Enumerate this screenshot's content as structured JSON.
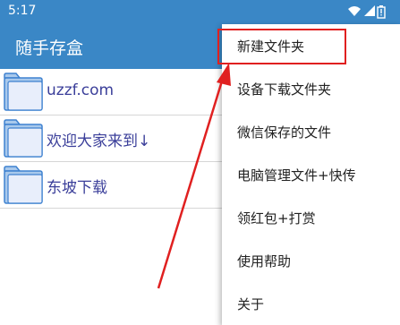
{
  "status_bar": {
    "time": "5:17",
    "icons": [
      "wifi-icon",
      "signal-icon",
      "battery-icon"
    ]
  },
  "app_bar": {
    "title": "随手存盒"
  },
  "folders": [
    {
      "label": "uzzf.com",
      "icon": "folder-icon"
    },
    {
      "label": "欢迎大家来到↓",
      "icon": "folder-icon"
    },
    {
      "label": "东坡下载",
      "icon": "folder-icon"
    }
  ],
  "menu": {
    "items": [
      {
        "label": "新建文件夹",
        "highlighted": true
      },
      {
        "label": "设备下载文件夹"
      },
      {
        "label": "微信保存的文件"
      },
      {
        "label": "电脑管理文件+快传"
      },
      {
        "label": "领红包+打赏"
      },
      {
        "label": "使用帮助"
      },
      {
        "label": "关于"
      }
    ]
  },
  "colors": {
    "primary": "#3a87c6",
    "folder_label": "#3b3f9a",
    "annotation": "#e02020"
  }
}
